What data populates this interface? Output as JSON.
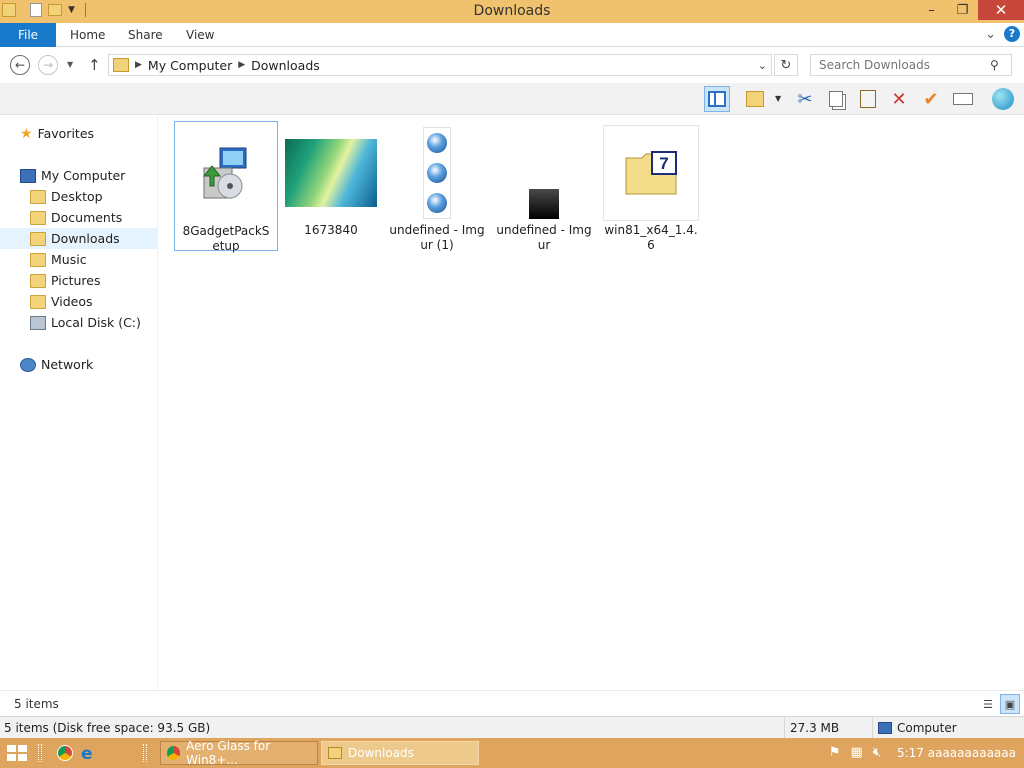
{
  "window": {
    "title": "Downloads",
    "minimize": "–",
    "maximize": "❐",
    "close": "✕"
  },
  "ribbon": {
    "tabs": [
      "File",
      "Home",
      "Share",
      "View"
    ],
    "expand": "⌄",
    "help": "?"
  },
  "address": {
    "segments": [
      "My Computer",
      "Downloads"
    ],
    "search_placeholder": "Search Downloads"
  },
  "nav": {
    "favorites": "Favorites",
    "my_computer": "My Computer",
    "items": [
      "Desktop",
      "Documents",
      "Downloads",
      "Music",
      "Pictures",
      "Videos",
      "Local Disk (C:)"
    ],
    "network": "Network",
    "selected": "Downloads"
  },
  "files": [
    {
      "name": "8GadgetPackSetup",
      "type": "installer"
    },
    {
      "name": "1673840",
      "type": "image"
    },
    {
      "name": "undefined - Imgur (1)",
      "type": "image-orbs"
    },
    {
      "name": "undefined - Imgur",
      "type": "image-dark"
    },
    {
      "name": "win81_x64_1.4.6",
      "type": "7z-archive"
    }
  ],
  "status": {
    "items_count": "5 items",
    "disk_info": "5 items (Disk free space: 93.5 GB)",
    "size": "27.3 MB",
    "location": "Computer"
  },
  "taskbar": {
    "apps": [
      {
        "label": "Aero Glass for Win8+...",
        "icon": "chrome-icon"
      },
      {
        "label": "Downloads",
        "icon": "folder-icon"
      }
    ],
    "clock": "5:17 aaaaaaaaaaaa"
  },
  "colors": {
    "titlebar": "#f0c26e",
    "file_tab": "#1979ca",
    "taskbar": "#dfa45e",
    "close_button": "#c7473a"
  }
}
